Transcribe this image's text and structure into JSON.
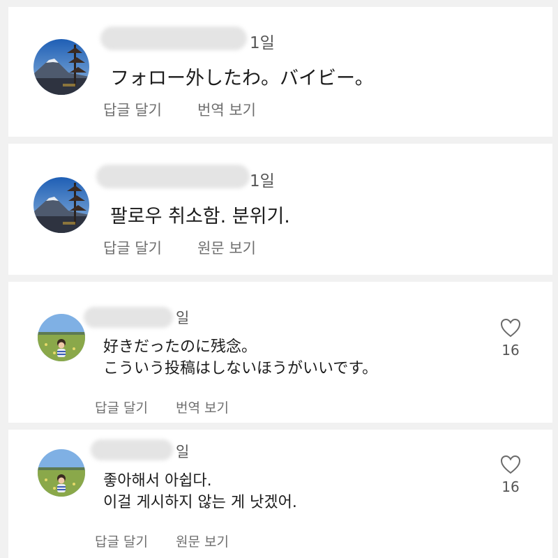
{
  "comments": [
    {
      "time": "1일",
      "text_lines": [
        "フォロー外したわ。バイビー。"
      ],
      "reply_label": "답글 달기",
      "translate_label": "번역 보기",
      "avatar": "mountain-pagoda-photo"
    },
    {
      "time": "1일",
      "text_lines": [
        "팔로우 취소함. 분위기."
      ],
      "reply_label": "답글 달기",
      "translate_label": "원문 보기",
      "avatar": "mountain-pagoda-photo"
    },
    {
      "time": "일",
      "text_lines": [
        "好きだったのに残念。",
        "こういう投稿はしないほうがいいです。"
      ],
      "reply_label": "답글 달기",
      "translate_label": "번역 보기",
      "likes": "16",
      "avatar": "child-in-field-photo"
    },
    {
      "time": "일",
      "text_lines": [
        "좋아해서 아쉽다.",
        "이걸 게시하지 않는 게 낫겠어."
      ],
      "reply_label": "답글 달기",
      "translate_label": "원문 보기",
      "likes": "16",
      "avatar": "child-in-field-photo"
    }
  ],
  "icons": {
    "like": "heart-outline-icon"
  },
  "colors": {
    "background": "#f1f1f1",
    "card": "#ffffff",
    "secondary_text": "#6e6e6e"
  }
}
